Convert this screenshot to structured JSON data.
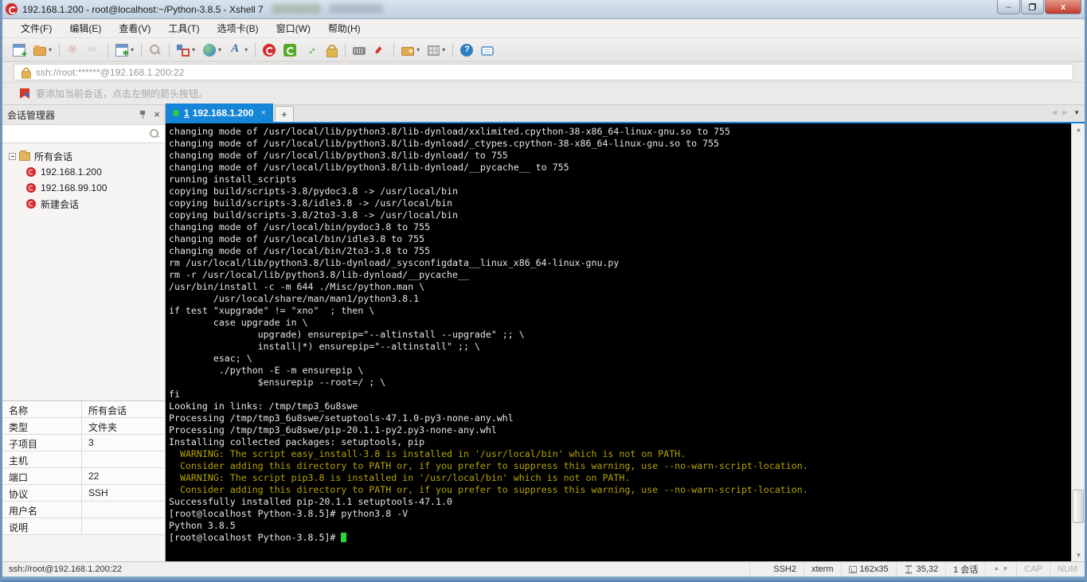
{
  "colors": {
    "tab_active": "#1585d8",
    "terminal_bg": "#000000",
    "terminal_text": "#e6e6e6",
    "warning_text": "#b5a300",
    "cursor": "#2ed52e",
    "xshell_red": "#d22b2b"
  },
  "window": {
    "title": "192.168.1.200 - root@localhost:~/Python-3.8.5 - Xshell 7",
    "controls": {
      "minimize": "–",
      "restore": "",
      "close": "x"
    }
  },
  "menu": {
    "items": [
      {
        "key": "file",
        "label": "文件(F)"
      },
      {
        "key": "edit",
        "label": "编辑(E)"
      },
      {
        "key": "view",
        "label": "查看(V)"
      },
      {
        "key": "tools",
        "label": "工具(T)"
      },
      {
        "key": "tabs",
        "label": "选项卡(B)"
      },
      {
        "key": "window",
        "label": "窗口(W)"
      },
      {
        "key": "help",
        "label": "帮助(H)"
      }
    ]
  },
  "toolbar": {
    "buttons": [
      {
        "name": "new-session",
        "dropdown": false,
        "disabled": false,
        "sep_after": false
      },
      {
        "name": "open-session",
        "dropdown": true,
        "disabled": false,
        "sep_after": true
      },
      {
        "name": "disconnect",
        "dropdown": false,
        "disabled": true,
        "sep_after": false
      },
      {
        "name": "reconnect-chain",
        "dropdown": false,
        "disabled": true,
        "sep_after": true
      },
      {
        "name": "session-properties",
        "dropdown": true,
        "disabled": false,
        "sep_after": true
      },
      {
        "name": "find",
        "dropdown": false,
        "disabled": false,
        "sep_after": true
      },
      {
        "name": "compose",
        "dropdown": true,
        "disabled": false,
        "sep_after": false
      },
      {
        "name": "web",
        "dropdown": true,
        "disabled": false,
        "sep_after": false
      },
      {
        "name": "font",
        "dropdown": true,
        "disabled": false,
        "sep_after": true
      },
      {
        "name": "xshell",
        "dropdown": false,
        "disabled": false,
        "sep_after": false
      },
      {
        "name": "xftp",
        "dropdown": false,
        "disabled": false,
        "sep_after": false
      },
      {
        "name": "fullscreen",
        "dropdown": false,
        "disabled": false,
        "sep_after": false
      },
      {
        "name": "lock",
        "dropdown": false,
        "disabled": false,
        "sep_after": true
      },
      {
        "name": "keyboard",
        "dropdown": false,
        "disabled": false,
        "sep_after": false
      },
      {
        "name": "highlight",
        "dropdown": false,
        "disabled": false,
        "sep_after": true
      },
      {
        "name": "new-file",
        "dropdown": true,
        "disabled": false,
        "sep_after": false
      },
      {
        "name": "layout-grid",
        "dropdown": true,
        "disabled": false,
        "sep_after": true
      },
      {
        "name": "help",
        "dropdown": false,
        "disabled": false,
        "sep_after": false
      },
      {
        "name": "feedback",
        "dropdown": false,
        "disabled": false,
        "sep_after": false
      }
    ]
  },
  "address_bar": {
    "url": "ssh://root:******@192.168.1.200:22"
  },
  "tip_bar": {
    "text": "要添加当前会话，点击左侧的箭头按钮。"
  },
  "session_manager": {
    "title": "会话管理器",
    "search_value": "",
    "root_label": "所有会话",
    "sessions": [
      "192.168.1.200",
      "192.168.99.100",
      "新建会话"
    ],
    "properties": [
      {
        "label": "名称",
        "value": "所有会话"
      },
      {
        "label": "类型",
        "value": "文件夹"
      },
      {
        "label": "子项目",
        "value": "3"
      },
      {
        "label": "主机",
        "value": ""
      },
      {
        "label": "端口",
        "value": "22"
      },
      {
        "label": "协议",
        "value": "SSH"
      },
      {
        "label": "用户名",
        "value": ""
      },
      {
        "label": "说明",
        "value": ""
      }
    ]
  },
  "tabs": {
    "active": {
      "index": "1",
      "title": "192.168.1.200",
      "close": "×"
    },
    "new_tab_label": "+",
    "prev_arrow": "◀",
    "next_arrow": "▶",
    "list_dropdown": "▼"
  },
  "terminal": {
    "lines": [
      {
        "t": "changing mode of /usr/local/lib/python3.8/lib-dynload/xxlimited.cpython-38-x86_64-linux-gnu.so to 755",
        "c": "normal"
      },
      {
        "t": "changing mode of /usr/local/lib/python3.8/lib-dynload/_ctypes.cpython-38-x86_64-linux-gnu.so to 755",
        "c": "normal"
      },
      {
        "t": "changing mode of /usr/local/lib/python3.8/lib-dynload/ to 755",
        "c": "normal"
      },
      {
        "t": "changing mode of /usr/local/lib/python3.8/lib-dynload/__pycache__ to 755",
        "c": "normal"
      },
      {
        "t": "running install_scripts",
        "c": "normal"
      },
      {
        "t": "copying build/scripts-3.8/pydoc3.8 -> /usr/local/bin",
        "c": "normal"
      },
      {
        "t": "copying build/scripts-3.8/idle3.8 -> /usr/local/bin",
        "c": "normal"
      },
      {
        "t": "copying build/scripts-3.8/2to3-3.8 -> /usr/local/bin",
        "c": "normal"
      },
      {
        "t": "changing mode of /usr/local/bin/pydoc3.8 to 755",
        "c": "normal"
      },
      {
        "t": "changing mode of /usr/local/bin/idle3.8 to 755",
        "c": "normal"
      },
      {
        "t": "changing mode of /usr/local/bin/2to3-3.8 to 755",
        "c": "normal"
      },
      {
        "t": "rm /usr/local/lib/python3.8/lib-dynload/_sysconfigdata__linux_x86_64-linux-gnu.py",
        "c": "normal"
      },
      {
        "t": "rm -r /usr/local/lib/python3.8/lib-dynload/__pycache__",
        "c": "normal"
      },
      {
        "t": "/usr/bin/install -c -m 644 ./Misc/python.man \\",
        "c": "normal"
      },
      {
        "t": "        /usr/local/share/man/man1/python3.8.1",
        "c": "normal"
      },
      {
        "t": "if test \"xupgrade\" != \"xno\"  ; then \\",
        "c": "normal"
      },
      {
        "t": "        case upgrade in \\",
        "c": "normal"
      },
      {
        "t": "                upgrade) ensurepip=\"--altinstall --upgrade\" ;; \\",
        "c": "normal"
      },
      {
        "t": "                install|*) ensurepip=\"--altinstall\" ;; \\",
        "c": "normal"
      },
      {
        "t": "        esac; \\",
        "c": "normal"
      },
      {
        "t": "         ./python -E -m ensurepip \\",
        "c": "normal"
      },
      {
        "t": "                $ensurepip --root=/ ; \\",
        "c": "normal"
      },
      {
        "t": "fi",
        "c": "normal"
      },
      {
        "t": "Looking in links: /tmp/tmp3_6u8swe",
        "c": "normal"
      },
      {
        "t": "Processing /tmp/tmp3_6u8swe/setuptools-47.1.0-py3-none-any.whl",
        "c": "normal"
      },
      {
        "t": "Processing /tmp/tmp3_6u8swe/pip-20.1.1-py2.py3-none-any.whl",
        "c": "normal"
      },
      {
        "t": "Installing collected packages: setuptools, pip",
        "c": "normal"
      },
      {
        "t": "  WARNING: The script easy_install-3.8 is installed in '/usr/local/bin' which is not on PATH.",
        "c": "warn"
      },
      {
        "t": "  Consider adding this directory to PATH or, if you prefer to suppress this warning, use --no-warn-script-location.",
        "c": "warn"
      },
      {
        "t": "  WARNING: The script pip3.8 is installed in '/usr/local/bin' which is not on PATH.",
        "c": "warn"
      },
      {
        "t": "  Consider adding this directory to PATH or, if you prefer to suppress this warning, use --no-warn-script-location.",
        "c": "warn"
      },
      {
        "t": "Successfully installed pip-20.1.1 setuptools-47.1.0",
        "c": "normal"
      },
      {
        "t": "[root@localhost Python-3.8.5]# python3.8 -V",
        "c": "normal"
      },
      {
        "t": "Python 3.8.5",
        "c": "normal"
      },
      {
        "t": "[root@localhost Python-3.8.5]# ",
        "c": "normal",
        "cursor": true
      }
    ]
  },
  "status_bar": {
    "left": "ssh://root@192.168.1.200:22",
    "segments": [
      {
        "name": "ssh-version",
        "icon": "lock-icon",
        "label": "SSH2",
        "dim": false
      },
      {
        "name": "term-type",
        "icon": "",
        "label": "xterm",
        "dim": false
      },
      {
        "name": "term-size",
        "icon": "resize-icon",
        "label": "162x35",
        "dim": false
      },
      {
        "name": "cursor-pos",
        "icon": "caret-icon",
        "label": "35,32",
        "dim": false
      },
      {
        "name": "session-count",
        "icon": "",
        "label": "1 会话",
        "dim": false
      },
      {
        "name": "scroll-arrows",
        "icon": "updown-icon",
        "label": "",
        "dim": false
      },
      {
        "name": "caps-indicator",
        "icon": "",
        "label": "CAP",
        "dim": true
      },
      {
        "name": "num-indicator",
        "icon": "",
        "label": "NUM",
        "dim": true
      }
    ]
  }
}
